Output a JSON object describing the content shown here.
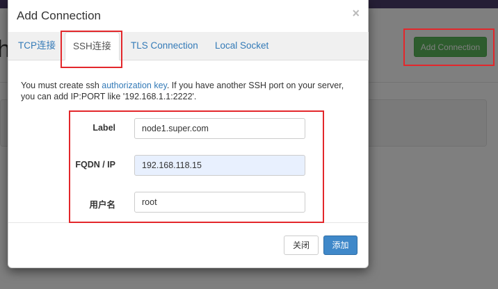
{
  "background": {
    "add_connection_label": "Add Connection"
  },
  "modal": {
    "title": "Add Connection",
    "close_glyph": "×",
    "tabs": [
      {
        "label": "TCP连接",
        "active": false
      },
      {
        "label": "SSH连接",
        "active": true
      },
      {
        "label": "TLS Connection",
        "active": false
      },
      {
        "label": "Local Socket",
        "active": false
      }
    ],
    "info": {
      "before": "You must create ssh ",
      "link": "authorization key",
      "after": ". If you have another SSH port on your server, you can add IP:PORT like '192.168.1.1:2222'."
    },
    "form": {
      "label_label": "Label",
      "label_value": "node1.super.com",
      "fqdn_label": "FQDN / IP",
      "fqdn_value": "192.168.118.15",
      "user_label": "用户名",
      "user_value": "root"
    },
    "footer": {
      "close_label": "关闭",
      "add_label": "添加"
    }
  },
  "colors": {
    "accent": "#337ab7",
    "primary_button": "#3f88c9",
    "success_button": "#5cb85c",
    "highlight_box": "#e3272b",
    "topbar": "#4b3c6b",
    "autofill": "#e8f0fe"
  }
}
